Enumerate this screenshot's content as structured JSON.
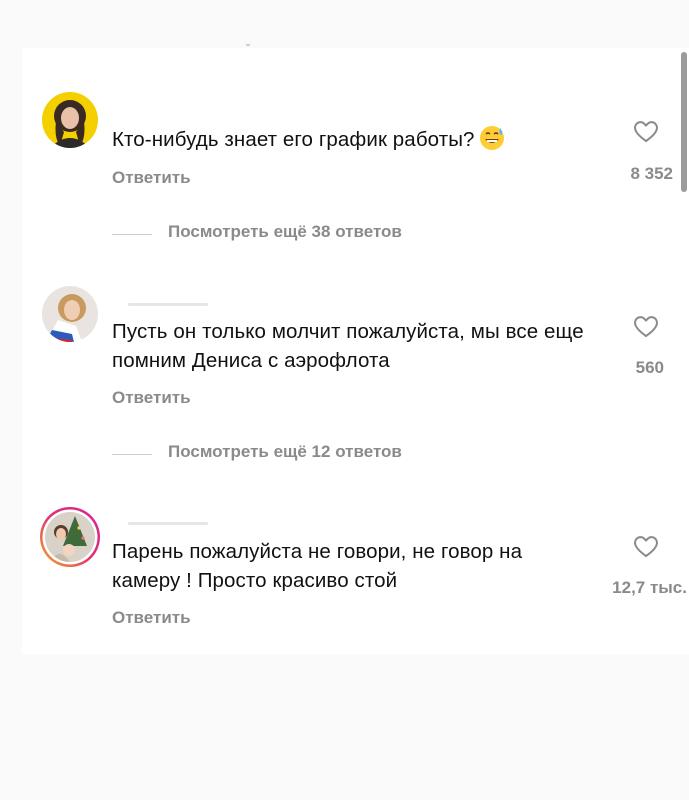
{
  "comments": [
    {
      "text": "Кто-нибудь знает его график работы?",
      "emoji": "grinning-sweat-emoji",
      "reply_label": "Ответить",
      "likes": "8 352",
      "more_replies": "Посмотреть ещё 38 ответов"
    },
    {
      "text": "Пусть он только молчит пожалуйста, мы все еще помним Дениса с аэрофлота",
      "reply_label": "Ответить",
      "likes": "560",
      "more_replies": "Посмотреть ещё 12 ответов"
    },
    {
      "text": "Парень пожалуйста не говори, не говор на камеру ! Просто красиво стой",
      "reply_label": "Ответить",
      "likes": "12,7 тыс."
    }
  ],
  "icons": {
    "like": "heart-outline-icon",
    "story_ring": "story-ring"
  },
  "colors": {
    "secondary_text": "#8a8a8a",
    "story_ring_start": "#f9a825",
    "story_ring_end": "#d6249f"
  }
}
